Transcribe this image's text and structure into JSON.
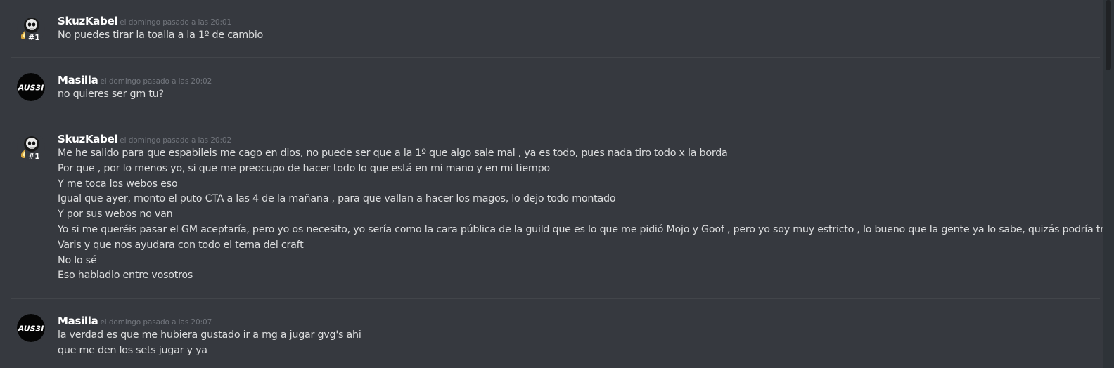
{
  "messages": [
    {
      "author": "SkuzKabel",
      "timestamp": "el domingo pasado a las 20:01",
      "avatar": "skull-rank-1-icon",
      "lines": [
        "No puedes tirar la toalla a la 1º de cambio"
      ]
    },
    {
      "author": "Masilla",
      "timestamp": "el domingo pasado a las 20:02",
      "avatar": "aus3i-logo-avatar",
      "lines": [
        "no quieres ser gm tu?"
      ]
    },
    {
      "author": "SkuzKabel",
      "timestamp": "el domingo pasado a las 20:02",
      "avatar": "skull-rank-1-icon",
      "lines": [
        "Me he salido para que espabileis me cago en dios, no puede ser que a la 1º que algo sale mal , ya es todo, pues nada tiro todo x la borda",
        "Por que , por lo menos yo, si que me preocupo de hacer todo lo que está en mi mano y en mi tiempo",
        "Y me toca los webos eso",
        "Igual que ayer, monto el puto CTA a las 4 de la mañana , para que vallan a hacer los magos, lo dejo todo montado",
        "Y por sus webos no van",
        "Yo si me queréis pasar el GM aceptaría, pero yo os necesito, yo sería como la cara pública de la guild que es lo que me pidió Mojo y Goof , pero yo soy muy estricto , lo bueno que la gente ya lo sabe, quizás podría traerme a",
        "Varis y que nos ayudara con todo el tema del craft",
        "No lo sé",
        "Eso habladlo entre vosotros"
      ]
    },
    {
      "author": "Masilla",
      "timestamp": "el domingo pasado a las 20:07",
      "avatar": "aus3i-logo-avatar",
      "lines": [
        "la verdad es que me hubiera gustado ir a mg a jugar gvg's ahi",
        "que me den los sets jugar y ya"
      ]
    }
  ],
  "avatars": {
    "skuzkabel": {
      "badge_text": "#1"
    },
    "masilla": {
      "logo_text": "AUS3I"
    }
  },
  "colors": {
    "background": "#36393f",
    "username": "#ffffff",
    "timestamp": "#72767d",
    "message_text": "#dcddde",
    "divider": "#42454a"
  }
}
